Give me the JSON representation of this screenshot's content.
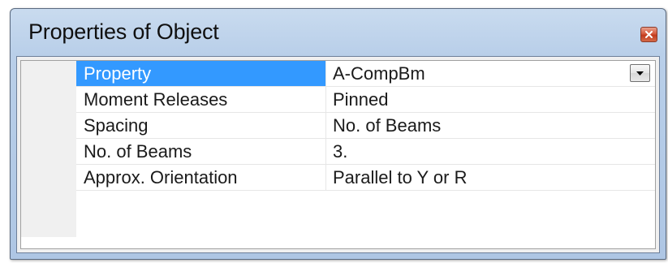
{
  "window": {
    "title": "Properties of Object"
  },
  "icons": {
    "close": "close-icon",
    "dropdown": "chevron-down-icon"
  },
  "colors": {
    "selection": "#3399ff",
    "close_button": "#c94a2c"
  },
  "properties": [
    {
      "name": "Property",
      "value": "A-CompBm",
      "selected": true,
      "has_dropdown": true
    },
    {
      "name": "Moment Releases",
      "value": "Pinned",
      "selected": false,
      "has_dropdown": false
    },
    {
      "name": "Spacing",
      "value": "No. of Beams",
      "selected": false,
      "has_dropdown": false
    },
    {
      "name": "No. of Beams",
      "value": "3.",
      "selected": false,
      "has_dropdown": false
    },
    {
      "name": "Approx. Orientation",
      "value": "Parallel to Y or R",
      "selected": false,
      "has_dropdown": false
    }
  ]
}
